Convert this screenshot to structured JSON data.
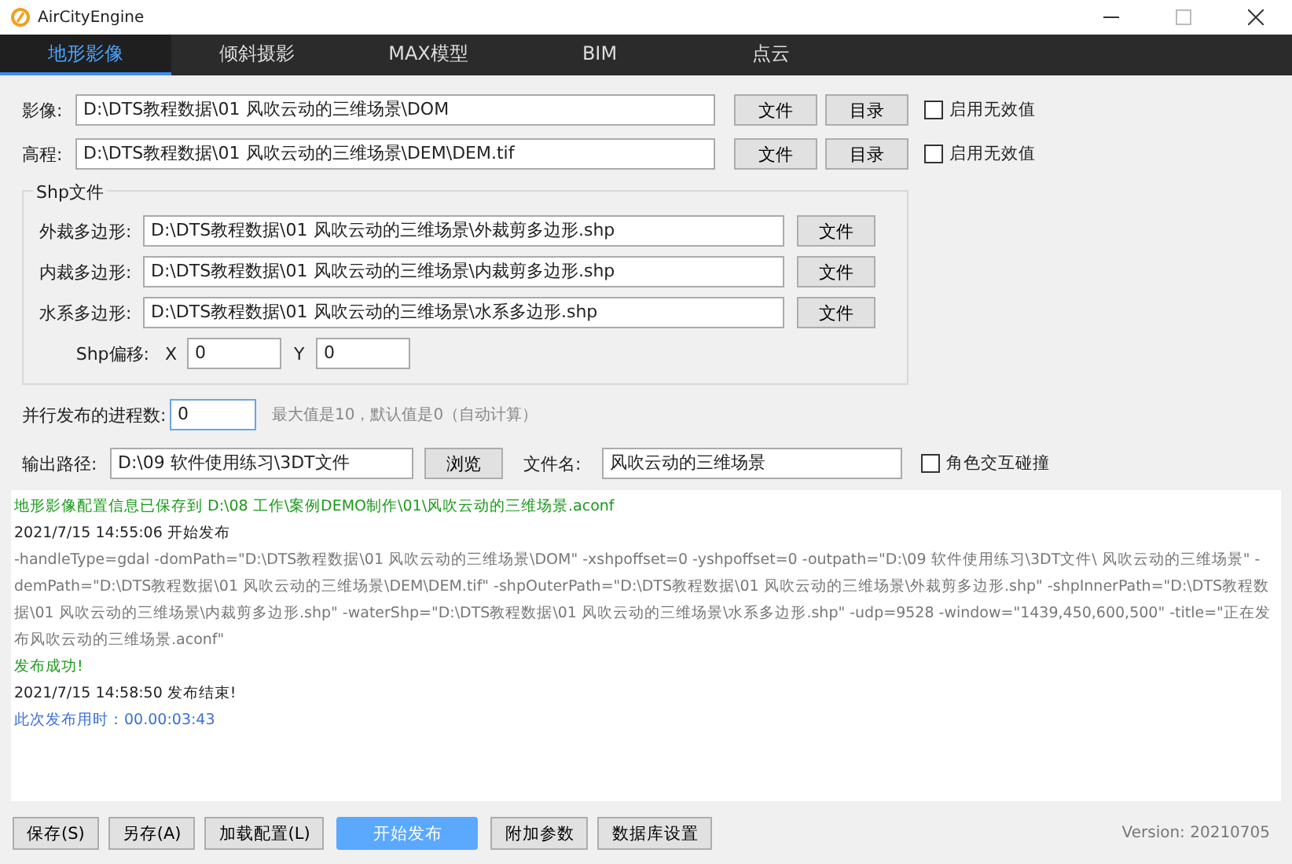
{
  "window": {
    "title": "AirCityEngine"
  },
  "tabs": [
    {
      "label": "地形影像",
      "selected": true
    },
    {
      "label": "倾斜摄影",
      "selected": false
    },
    {
      "label": "MAX模型",
      "selected": false
    },
    {
      "label": "BIM",
      "selected": false
    },
    {
      "label": "点云",
      "selected": false
    }
  ],
  "source_rows": [
    {
      "label": "影像:",
      "value": "D:\\DTS教程数据\\01 风吹云动的三维场景\\DOM",
      "file_button": "文件",
      "dir_button": "目录",
      "checkbox": {
        "label": "启用无效值",
        "checked": false
      }
    },
    {
      "label": "高程:",
      "value": "D:\\DTS教程数据\\01 风吹云动的三维场景\\DEM\\DEM.tif",
      "file_button": "文件",
      "dir_button": "目录",
      "checkbox": {
        "label": "启用无效值",
        "checked": false
      }
    }
  ],
  "shp_group": {
    "title": "Shp文件",
    "rows": [
      {
        "label": "外裁多边形:",
        "value": "D:\\DTS教程数据\\01 风吹云动的三维场景\\外裁剪多边形.shp",
        "button": "文件"
      },
      {
        "label": "内裁多边形:",
        "value": "D:\\DTS教程数据\\01 风吹云动的三维场景\\内裁剪多边形.shp",
        "button": "文件"
      },
      {
        "label": "水系多边形:",
        "value": "D:\\DTS教程数据\\01 风吹云动的三维场景\\水系多边形.shp",
        "button": "文件"
      }
    ],
    "offset": {
      "label": "Shp偏移:",
      "x_label": "X",
      "x_value": "0",
      "y_label": "Y",
      "y_value": "0"
    }
  },
  "process_count": {
    "label": "并行发布的进程数:",
    "value": "0",
    "hint": "最大值是10，默认值是0（自动计算）"
  },
  "output": {
    "label": "输出路径:",
    "value": "D:\\09 软件使用练习\\3DT文件",
    "browse_button": "浏览",
    "filename_label": "文件名:",
    "filename_value": "风吹云动的三维场景",
    "checkbox": {
      "label": "角色交互碰撞",
      "checked": false
    }
  },
  "log": [
    {
      "kind": "success",
      "text": "地形影像配置信息已保存到 D:\\08 工作\\案例DEMO制作\\01\\风吹云动的三维场景.aconf"
    },
    {
      "kind": "info",
      "text": "2021/7/15 14:55:06 开始发布"
    },
    {
      "kind": "command",
      "text": " -handleType=gdal -domPath=\"D:\\DTS教程数据\\01 风吹云动的三维场景\\DOM\" -xshpoffset=0 -yshpoffset=0 -outpath=\"D:\\09 软件使用练习\\3DT文件\\ 风吹云动的三维场景\" -demPath=\"D:\\DTS教程数据\\01 风吹云动的三维场景\\DEM\\DEM.tif\" -shpOuterPath=\"D:\\DTS教程数据\\01 风吹云动的三维场景\\外裁剪多边形.shp\" -shpInnerPath=\"D:\\DTS教程数据\\01 风吹云动的三维场景\\内裁剪多边形.shp\" -waterShp=\"D:\\DTS教程数据\\01 风吹云动的三维场景\\水系多边形.shp\" -udp=9528 -window=\"1439,450,600,500\" -title=\"正在发布风吹云动的三维场景.aconf\""
    },
    {
      "kind": "success",
      "text": "发布成功!"
    },
    {
      "kind": "info",
      "text": "2021/7/15 14:58:50 发布结束!"
    },
    {
      "kind": "timing",
      "text": "此次发布用时：00.00:03:43"
    }
  ],
  "bottom_buttons": [
    {
      "label": "保存(S)",
      "primary": false
    },
    {
      "label": "另存(A)",
      "primary": false
    },
    {
      "label": "加载配置(L)",
      "primary": false
    },
    {
      "label": "开始发布",
      "primary": true
    },
    {
      "label": "附加参数",
      "primary": false
    },
    {
      "label": "数据库设置",
      "primary": false
    }
  ],
  "version": "Version: 20210705"
}
